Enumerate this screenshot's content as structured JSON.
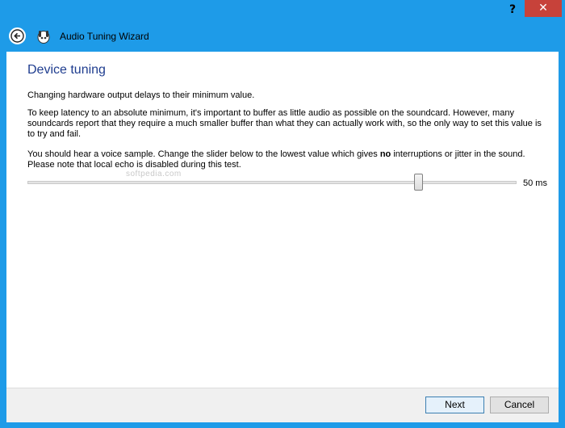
{
  "titlebar": {
    "help_label": "?",
    "close_label": "✕"
  },
  "header": {
    "title": "Audio Tuning Wizard"
  },
  "page": {
    "heading": "Device tuning",
    "para1": "Changing hardware output delays to their minimum value.",
    "para2": "To keep latency to an absolute minimum, it's important to buffer as little audio as possible on the soundcard. However, many soundcards report that they require a much smaller buffer than what they can actually work with, so the only way to set this value is to try and fail.",
    "para3_before": "You should hear a voice sample. Change the slider below to the lowest value which gives ",
    "para3_bold": "no",
    "para3_after": " interruptions or jitter in the sound. Please note that local echo is disabled during this test.",
    "watermark": "softpedia.com"
  },
  "slider": {
    "value_label": "50 ms",
    "position_fraction": 0.8
  },
  "footer": {
    "next_label": "Next",
    "cancel_label": "Cancel"
  },
  "colors": {
    "frame": "#1e9be8",
    "close": "#c7423a",
    "heading": "#1f3d8f"
  }
}
